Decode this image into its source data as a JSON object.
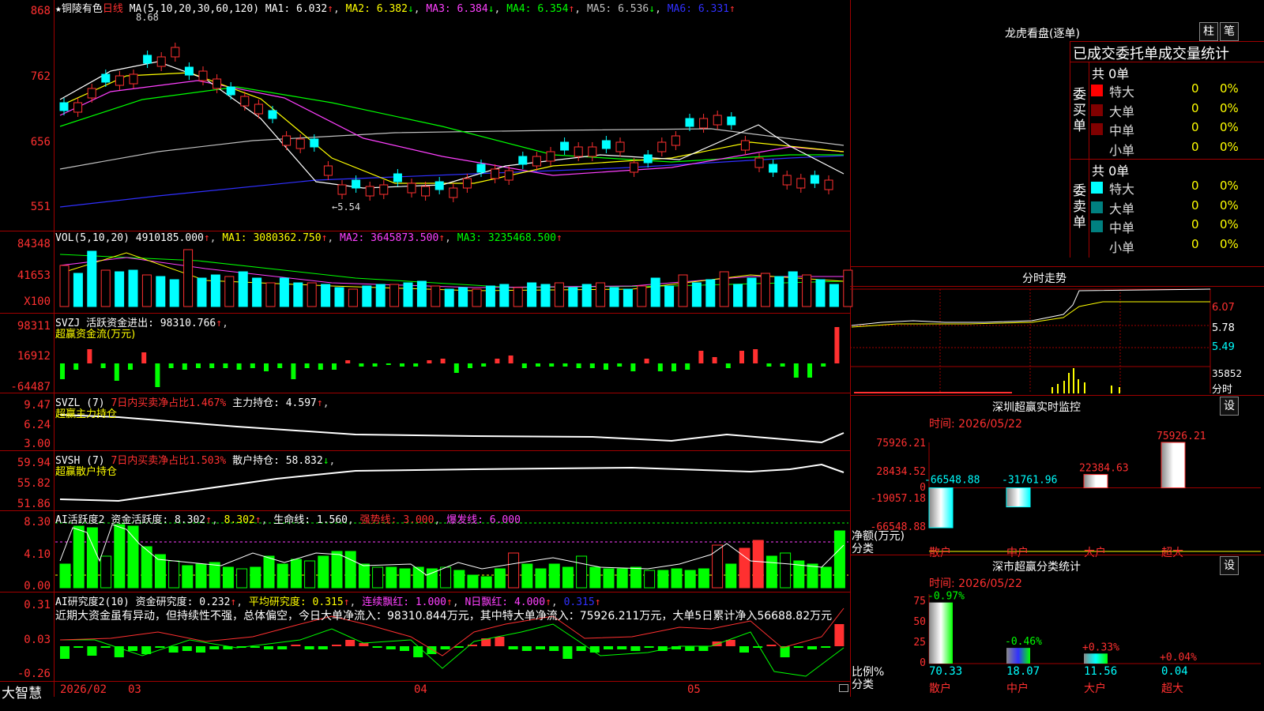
{
  "stock": {
    "star": "★",
    "name": "铜陵有色",
    "period": "日线",
    "peak_label": "8.68",
    "low_label": "5.54"
  },
  "ma_line": {
    "label": "MA(5,10,20,30,60,120)",
    "ma1": "MA1: 6.032",
    "ma2": "MA2: 6.382",
    "ma3": "MA3: 6.384",
    "ma4": "MA4: 6.354",
    "ma5": "MA5: 6.536",
    "ma6": "MA6: 6.331"
  },
  "price_axis": [
    "868",
    "762",
    "656",
    "551"
  ],
  "vol_line": {
    "label": "VOL(5,10,20)",
    "vol": "4910185.000",
    "ma1": "MA1: 3080362.750",
    "ma2": "MA2: 3645873.500",
    "ma3": "MA3: 3235468.500"
  },
  "vol_axis": [
    "84348",
    "41653",
    "X100"
  ],
  "svzj": {
    "label": "SVZJ",
    "active_label": "活跃资金进出: 98310.766",
    "subtitle": "超赢资金流(万元)",
    "axis": [
      "98311",
      "16912",
      "-64487"
    ]
  },
  "svzl": {
    "label": "SVZL (7)",
    "ratio": "7日内买卖净占比1.467%",
    "hold": "主力持仓: 4.597",
    "subtitle": "超赢主力持仓",
    "axis": [
      "9.47",
      "6.24",
      "3.00"
    ]
  },
  "svsh": {
    "label": "SVSH (7)",
    "ratio": "7日内买卖净占比1.503%",
    "hold": "散户持仓: 58.832",
    "subtitle": "超赢散户持仓",
    "axis": [
      "59.94",
      "55.82",
      "51.86"
    ]
  },
  "ai_active": {
    "label": "AI活跃度2",
    "active": "资金活跃度: 8.302",
    "v2": "8.302",
    "life": "生命线: 1.560",
    "strong": "强势线: 3.000",
    "burst": "爆发线: 6.000",
    "axis": [
      "8.30",
      "4.10",
      "0.00"
    ]
  },
  "ai_research": {
    "label": "AI研究度2(10)",
    "research": "资金研究度: 0.232",
    "avg": "平均研究度: 0.315",
    "cont": "连续飘红: 1.000",
    "nday": "N日飘红: 4.000",
    "last": "0.315",
    "axis": [
      "0.31",
      "0.03",
      "-0.26"
    ],
    "comment": "近期大资金虽有异动，但持续性不强，总体偏空，今日大单净流入：98310.844万元，其中特大单净流入：75926.211万元，大单5日累计净入56688.82万元"
  },
  "footer": {
    "brand": "大智慧",
    "dates": [
      "2026/02",
      "03",
      "04",
      "05"
    ]
  },
  "right": {
    "lhb_title": "龙虎看盘(逐单)",
    "btn1": "柱",
    "btn2": "笔",
    "section_title": "已成交委托单成交量统计",
    "buy_label": "委买单",
    "sell_label": "委卖单",
    "buy_total": "共 0单",
    "sell_total": "共 0单",
    "buy_rows": [
      {
        "name": "特大",
        "v": "0",
        "p": "0%",
        "color": "#ff0000"
      },
      {
        "name": "大单",
        "v": "0",
        "p": "0%",
        "color": "#800000"
      },
      {
        "name": "中单",
        "v": "0",
        "p": "0%",
        "color": "#800000"
      },
      {
        "name": "小单",
        "v": "0",
        "p": "0%",
        "color": "#000000"
      }
    ],
    "sell_rows": [
      {
        "name": "特大",
        "v": "0",
        "p": "0%",
        "color": "#00ffff"
      },
      {
        "name": "大单",
        "v": "0",
        "p": "0%",
        "color": "#008080"
      },
      {
        "name": "中单",
        "v": "0",
        "p": "0%",
        "color": "#008080"
      },
      {
        "name": "小单",
        "v": "0",
        "p": "0%",
        "color": "#000000"
      }
    ],
    "intraday_title": "分时走势",
    "intraday_axis": [
      "6.07",
      "5.78",
      "5.49",
      "35852",
      "分时"
    ],
    "sz_title": "深圳超赢实时监控",
    "sz_time": "时间: 2026/05/22",
    "sz_btn": "设",
    "sz_axis": [
      "75926.21",
      "28434.52",
      "0",
      "-19057.18",
      "-66548.88"
    ],
    "sz_unit": "净额(万元)",
    "sz_cat": "分类",
    "sz_bars": [
      {
        "cat": "散户",
        "value": -66548.88,
        "label": "-66548.88"
      },
      {
        "cat": "中户",
        "value": -31761.96,
        "label": "-31761.96"
      },
      {
        "cat": "大户",
        "value": 22384.63,
        "label": "22384.63"
      },
      {
        "cat": "超大",
        "value": 75926.21,
        "label": "75926.21"
      }
    ],
    "stat_title": "深市超赢分类统计",
    "stat_time": "时间: 2026/05/22",
    "stat_btn": "设",
    "stat_axis": [
      "75",
      "50",
      "25",
      "0"
    ],
    "stat_unit": "比例%",
    "stat_cat": "分类",
    "stat_bars": [
      {
        "cat": "散户",
        "value": 70.33,
        "label": "70.33",
        "chg": "-0.97%"
      },
      {
        "cat": "中户",
        "value": 18.07,
        "label": "18.07",
        "chg": "-0.46%"
      },
      {
        "cat": "大户",
        "value": 11.56,
        "label": "11.56",
        "chg": "+0.33%"
      },
      {
        "cat": "超大",
        "value": 0.04,
        "label": "0.04",
        "chg": "+0.04%"
      }
    ]
  },
  "colors": {
    "up": "#ff3030",
    "down": "#00ffff",
    "grid": "#a00000"
  },
  "chart_data": {
    "type": "bar",
    "title": "深圳超赢实时监控",
    "categories": [
      "散户",
      "中户",
      "大户",
      "超大"
    ],
    "series": [
      {
        "values": [
          -66548.88,
          -31761.96,
          22384.63,
          75926.21
        ]
      }
    ],
    "ylabel": "净额(万元)",
    "ylim": [
      -66548.88,
      75926.21
    ]
  }
}
